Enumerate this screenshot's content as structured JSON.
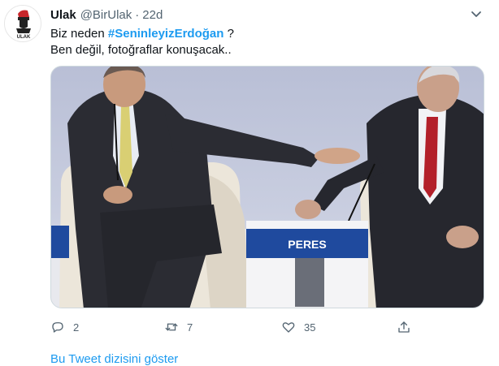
{
  "tweet": {
    "display_name": "Ulak",
    "handle": "@BirUlak",
    "separator": "·",
    "time": "22d",
    "text_line1_pre": "Biz neden ",
    "hashtag": "#SeninleyizErdoğan",
    "text_line1_post": " ?",
    "text_line2": "Ben değil, fotoğraflar konuşacak..",
    "avatar_text": "ULAK",
    "media": {
      "nameplate": "PERES"
    },
    "actions": {
      "reply_icon": "reply-icon",
      "reply_count": "2",
      "retweet_icon": "retweet-icon",
      "retweet_count": "7",
      "like_icon": "heart-icon",
      "like_count": "35",
      "share_icon": "share-icon"
    },
    "show_thread": "Bu Tweet dizisini göster"
  },
  "colors": {
    "link": "#1d9bf0",
    "text": "#0f1419",
    "secondary": "#536471"
  }
}
